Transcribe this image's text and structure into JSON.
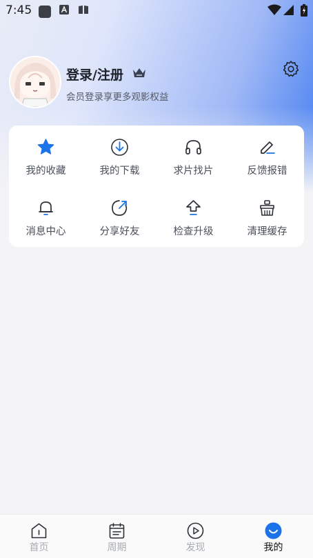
{
  "status_bar": {
    "time": "7:45"
  },
  "profile": {
    "title": "登录/注册",
    "subtitle": "会员登录享更多观影权益"
  },
  "tools": [
    {
      "label": "我的收藏",
      "icon": "star-icon"
    },
    {
      "label": "我的下载",
      "icon": "download-icon"
    },
    {
      "label": "求片找片",
      "icon": "headphones-icon"
    },
    {
      "label": "反馈报错",
      "icon": "edit-icon"
    },
    {
      "label": "消息中心",
      "icon": "bell-icon"
    },
    {
      "label": "分享好友",
      "icon": "share-icon"
    },
    {
      "label": "检查升级",
      "icon": "upgrade-icon"
    },
    {
      "label": "清理缓存",
      "icon": "clean-cache-icon"
    }
  ],
  "bottom_nav": [
    {
      "label": "首页",
      "icon": "home-icon"
    },
    {
      "label": "周期",
      "icon": "calendar-icon"
    },
    {
      "label": "发现",
      "icon": "play-icon"
    },
    {
      "label": "我的",
      "icon": "smile-icon",
      "active": true
    }
  ],
  "colors": {
    "accent": "#1a73e8",
    "active_tab": "#1a73e8"
  }
}
